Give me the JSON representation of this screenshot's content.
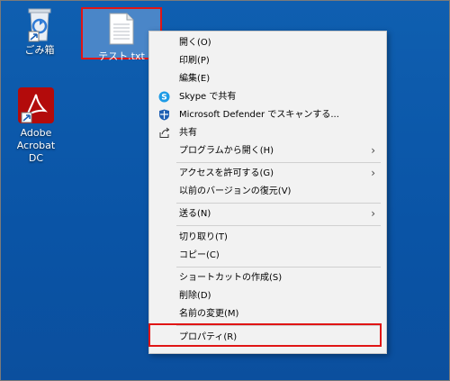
{
  "desktop": {
    "recycle_bin_label": "ごみ箱",
    "acrobat_label_line1": "Adobe Acrobat",
    "acrobat_label_line2": "DC",
    "selected_file_label": "テスト.txt"
  },
  "context_menu": {
    "items": [
      {
        "label": "開く(O)",
        "icon": null
      },
      {
        "label": "印刷(P)",
        "icon": null
      },
      {
        "label": "編集(E)",
        "icon": null
      },
      {
        "label": "Skype で共有",
        "icon": "skype-icon"
      },
      {
        "label": "Microsoft Defender でスキャンする...",
        "icon": "defender-icon"
      },
      {
        "label": "共有",
        "icon": "share-icon"
      },
      {
        "label": "プログラムから開く(H)",
        "icon": null,
        "submenu": true
      },
      {
        "label": "アクセスを許可する(G)",
        "icon": null,
        "submenu": true
      },
      {
        "label": "以前のバージョンの復元(V)",
        "icon": null
      },
      {
        "label": "送る(N)",
        "icon": null,
        "submenu": true
      },
      {
        "label": "切り取り(T)",
        "icon": null
      },
      {
        "label": "コピー(C)",
        "icon": null
      },
      {
        "label": "ショートカットの作成(S)",
        "icon": null
      },
      {
        "label": "削除(D)",
        "icon": null
      },
      {
        "label": "名前の変更(M)",
        "icon": null
      },
      {
        "label": "プロパティ(R)",
        "icon": null
      }
    ]
  },
  "colors": {
    "desktop_bg": "#0b56a8",
    "highlight_border": "#e01515",
    "menu_bg": "#f2f2f2",
    "skype_blue": "#1e9be6",
    "defender_blue": "#1f5fb3"
  }
}
